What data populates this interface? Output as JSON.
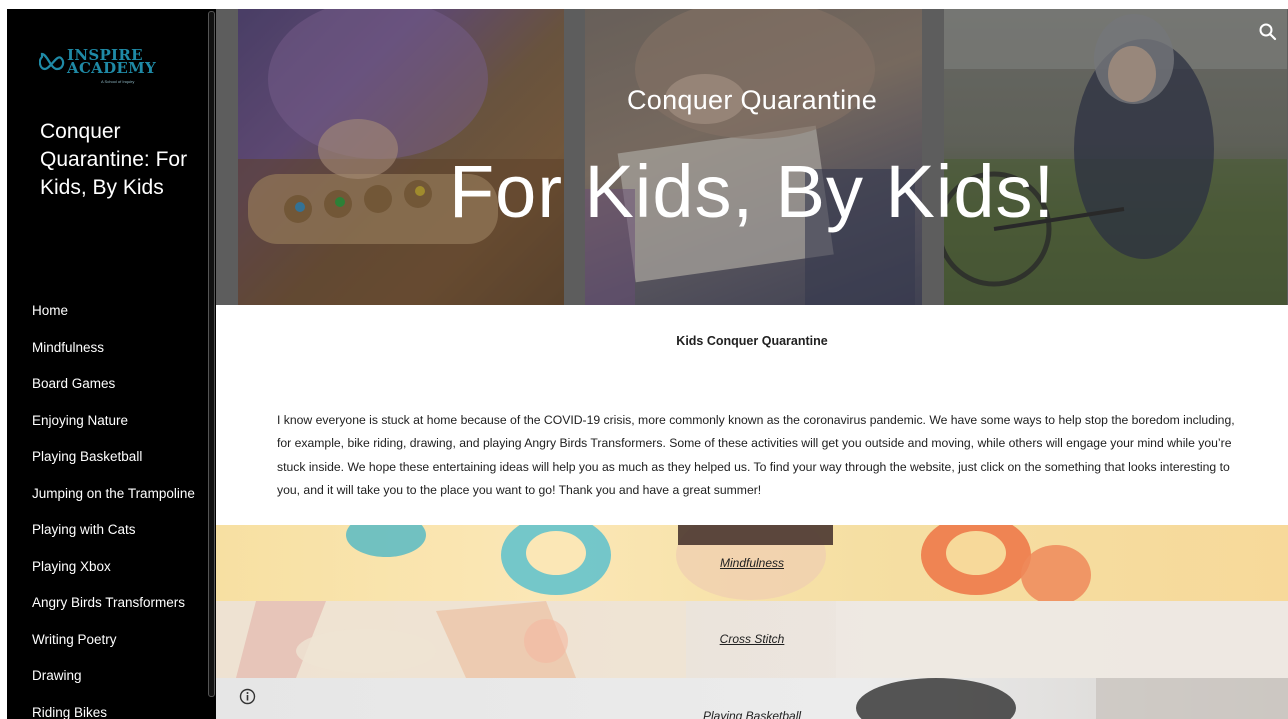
{
  "colors": {
    "sidebar_bg": "#000000",
    "logo_accent": "#1f8aa6",
    "text_dark": "#212121",
    "banner_mindfulness": "#f7e0a2"
  },
  "logo": {
    "name": "INSPIRE ACADEMY",
    "line1": "INSPIRE",
    "line2": "ACADEMY",
    "tagline": "A School of Inquiry",
    "icon": "infinity-loop-logo-icon"
  },
  "site_title": "Conquer Quarantine: For Kids, By Kids",
  "nav": [
    "Home",
    "Mindfulness",
    "Board Games",
    "Enjoying Nature",
    "Playing Basketball",
    "Jumping on the Trampoline",
    "Playing with Cats",
    "Playing Xbox",
    "Angry Birds Transformers",
    "Writing Poetry",
    "Drawing",
    "Riding Bikes"
  ],
  "hero": {
    "eyebrow": "Conquer Quarantine",
    "title": "For Kids, By Kids!",
    "search_icon": "search-icon"
  },
  "content": {
    "heading": "Kids Conquer Quarantine",
    "intro": "I know everyone is stuck at home because of the COVID-19 crisis, more commonly known as the coronavirus pandemic. We have some ways to help stop the boredom including, for example, bike riding, drawing, and playing Angry Birds Transformers. Some of these activities will get you outside and moving, while others will engage your mind while you’re stuck inside. We hope these entertaining ideas will help you as much as they helped us. To find your way through the website, just click on the something that looks interesting to you, and it will take you to the place you want to go! Thank you and have a great summer!"
  },
  "banners": [
    {
      "label": "Mindfulness"
    },
    {
      "label": "Cross Stitch"
    },
    {
      "label": "Playing Basketball"
    }
  ],
  "info_icon": "info-icon"
}
